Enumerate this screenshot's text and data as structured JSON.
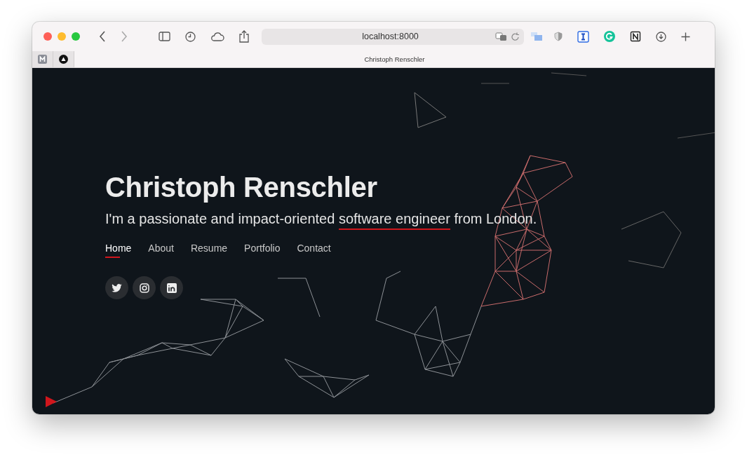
{
  "browser": {
    "address": "localhost:8000",
    "pinned_tabs": [
      {
        "kind": "m"
      },
      {
        "kind": "triangle"
      }
    ],
    "tab_title": "Christoph Renschler"
  },
  "hero": {
    "title": "Christoph Renschler",
    "subtitle": {
      "before": "I'm a passionate and impact-oriented ",
      "highlight": "software engineer",
      "after": " from London."
    },
    "nav": [
      {
        "label": "Home",
        "selected": true
      },
      {
        "label": "About",
        "selected": false
      },
      {
        "label": "Resume",
        "selected": false
      },
      {
        "label": "Portfolio",
        "selected": false
      },
      {
        "label": "Contact",
        "selected": false
      }
    ],
    "social": [
      {
        "kind": "twitter"
      },
      {
        "kind": "instagram"
      },
      {
        "kind": "linkedin"
      }
    ]
  }
}
